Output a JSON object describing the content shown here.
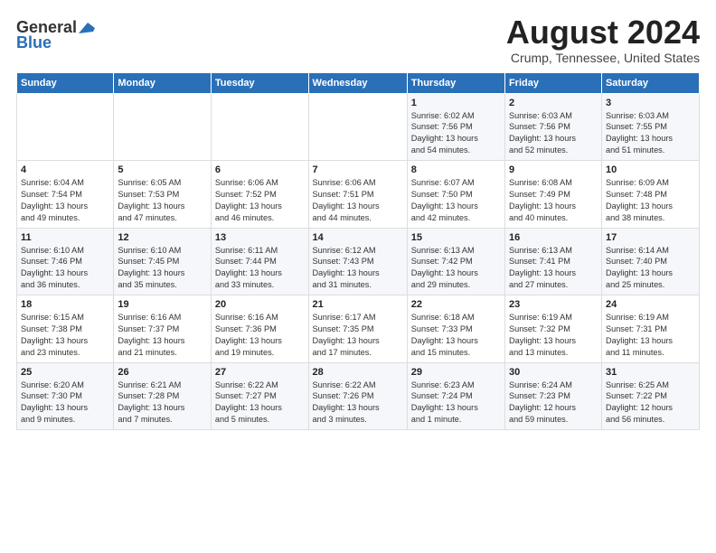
{
  "logo": {
    "line1": "General",
    "line2": "Blue"
  },
  "title": "August 2024",
  "subtitle": "Crump, Tennessee, United States",
  "columns": [
    "Sunday",
    "Monday",
    "Tuesday",
    "Wednesday",
    "Thursday",
    "Friday",
    "Saturday"
  ],
  "weeks": [
    [
      {
        "day": "",
        "detail": ""
      },
      {
        "day": "",
        "detail": ""
      },
      {
        "day": "",
        "detail": ""
      },
      {
        "day": "",
        "detail": ""
      },
      {
        "day": "1",
        "detail": "Sunrise: 6:02 AM\nSunset: 7:56 PM\nDaylight: 13 hours\nand 54 minutes."
      },
      {
        "day": "2",
        "detail": "Sunrise: 6:03 AM\nSunset: 7:56 PM\nDaylight: 13 hours\nand 52 minutes."
      },
      {
        "day": "3",
        "detail": "Sunrise: 6:03 AM\nSunset: 7:55 PM\nDaylight: 13 hours\nand 51 minutes."
      }
    ],
    [
      {
        "day": "4",
        "detail": "Sunrise: 6:04 AM\nSunset: 7:54 PM\nDaylight: 13 hours\nand 49 minutes."
      },
      {
        "day": "5",
        "detail": "Sunrise: 6:05 AM\nSunset: 7:53 PM\nDaylight: 13 hours\nand 47 minutes."
      },
      {
        "day": "6",
        "detail": "Sunrise: 6:06 AM\nSunset: 7:52 PM\nDaylight: 13 hours\nand 46 minutes."
      },
      {
        "day": "7",
        "detail": "Sunrise: 6:06 AM\nSunset: 7:51 PM\nDaylight: 13 hours\nand 44 minutes."
      },
      {
        "day": "8",
        "detail": "Sunrise: 6:07 AM\nSunset: 7:50 PM\nDaylight: 13 hours\nand 42 minutes."
      },
      {
        "day": "9",
        "detail": "Sunrise: 6:08 AM\nSunset: 7:49 PM\nDaylight: 13 hours\nand 40 minutes."
      },
      {
        "day": "10",
        "detail": "Sunrise: 6:09 AM\nSunset: 7:48 PM\nDaylight: 13 hours\nand 38 minutes."
      }
    ],
    [
      {
        "day": "11",
        "detail": "Sunrise: 6:10 AM\nSunset: 7:46 PM\nDaylight: 13 hours\nand 36 minutes."
      },
      {
        "day": "12",
        "detail": "Sunrise: 6:10 AM\nSunset: 7:45 PM\nDaylight: 13 hours\nand 35 minutes."
      },
      {
        "day": "13",
        "detail": "Sunrise: 6:11 AM\nSunset: 7:44 PM\nDaylight: 13 hours\nand 33 minutes."
      },
      {
        "day": "14",
        "detail": "Sunrise: 6:12 AM\nSunset: 7:43 PM\nDaylight: 13 hours\nand 31 minutes."
      },
      {
        "day": "15",
        "detail": "Sunrise: 6:13 AM\nSunset: 7:42 PM\nDaylight: 13 hours\nand 29 minutes."
      },
      {
        "day": "16",
        "detail": "Sunrise: 6:13 AM\nSunset: 7:41 PM\nDaylight: 13 hours\nand 27 minutes."
      },
      {
        "day": "17",
        "detail": "Sunrise: 6:14 AM\nSunset: 7:40 PM\nDaylight: 13 hours\nand 25 minutes."
      }
    ],
    [
      {
        "day": "18",
        "detail": "Sunrise: 6:15 AM\nSunset: 7:38 PM\nDaylight: 13 hours\nand 23 minutes."
      },
      {
        "day": "19",
        "detail": "Sunrise: 6:16 AM\nSunset: 7:37 PM\nDaylight: 13 hours\nand 21 minutes."
      },
      {
        "day": "20",
        "detail": "Sunrise: 6:16 AM\nSunset: 7:36 PM\nDaylight: 13 hours\nand 19 minutes."
      },
      {
        "day": "21",
        "detail": "Sunrise: 6:17 AM\nSunset: 7:35 PM\nDaylight: 13 hours\nand 17 minutes."
      },
      {
        "day": "22",
        "detail": "Sunrise: 6:18 AM\nSunset: 7:33 PM\nDaylight: 13 hours\nand 15 minutes."
      },
      {
        "day": "23",
        "detail": "Sunrise: 6:19 AM\nSunset: 7:32 PM\nDaylight: 13 hours\nand 13 minutes."
      },
      {
        "day": "24",
        "detail": "Sunrise: 6:19 AM\nSunset: 7:31 PM\nDaylight: 13 hours\nand 11 minutes."
      }
    ],
    [
      {
        "day": "25",
        "detail": "Sunrise: 6:20 AM\nSunset: 7:30 PM\nDaylight: 13 hours\nand 9 minutes."
      },
      {
        "day": "26",
        "detail": "Sunrise: 6:21 AM\nSunset: 7:28 PM\nDaylight: 13 hours\nand 7 minutes."
      },
      {
        "day": "27",
        "detail": "Sunrise: 6:22 AM\nSunset: 7:27 PM\nDaylight: 13 hours\nand 5 minutes."
      },
      {
        "day": "28",
        "detail": "Sunrise: 6:22 AM\nSunset: 7:26 PM\nDaylight: 13 hours\nand 3 minutes."
      },
      {
        "day": "29",
        "detail": "Sunrise: 6:23 AM\nSunset: 7:24 PM\nDaylight: 13 hours\nand 1 minute."
      },
      {
        "day": "30",
        "detail": "Sunrise: 6:24 AM\nSunset: 7:23 PM\nDaylight: 12 hours\nand 59 minutes."
      },
      {
        "day": "31",
        "detail": "Sunrise: 6:25 AM\nSunset: 7:22 PM\nDaylight: 12 hours\nand 56 minutes."
      }
    ]
  ]
}
